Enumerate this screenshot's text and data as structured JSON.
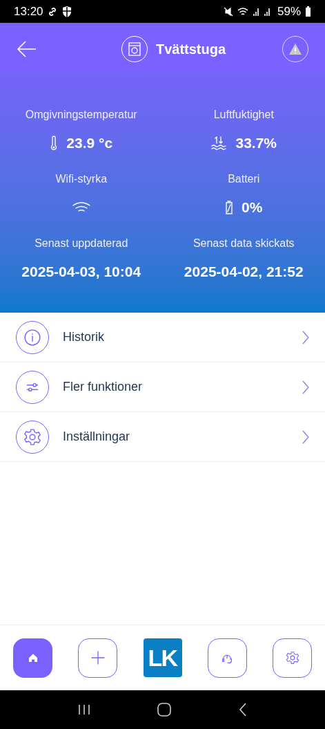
{
  "status_bar": {
    "time": "13:20",
    "battery": "59%"
  },
  "header": {
    "title": "Tvättstuga"
  },
  "stats": [
    {
      "label": "Omgivningstemperatur",
      "kind": "temperature",
      "value": "23.9 °c"
    },
    {
      "label": "Luftfuktighet",
      "kind": "humidity",
      "value": "33.7%"
    },
    {
      "label": "Wifi-styrka",
      "kind": "wifi"
    },
    {
      "label": "Batteri",
      "kind": "battery",
      "value": "0%"
    },
    {
      "label": "Senast uppdaterad",
      "kind": "date",
      "value": "2025-04-03, 10:04"
    },
    {
      "label": "Senast data skickats",
      "kind": "date",
      "value": "2025-04-02, 21:52"
    }
  ],
  "menu": [
    {
      "label": "Historik",
      "kind": "info"
    },
    {
      "label": "Fler funktioner",
      "kind": "sliders"
    },
    {
      "label": "Inställningar",
      "kind": "settings"
    }
  ],
  "bottom_nav": [
    {
      "kind": "home",
      "selected": true
    },
    {
      "kind": "add",
      "selected": false
    },
    {
      "kind": "logo",
      "label": "LK"
    },
    {
      "kind": "support",
      "selected": false
    },
    {
      "kind": "settings",
      "selected": false
    }
  ]
}
